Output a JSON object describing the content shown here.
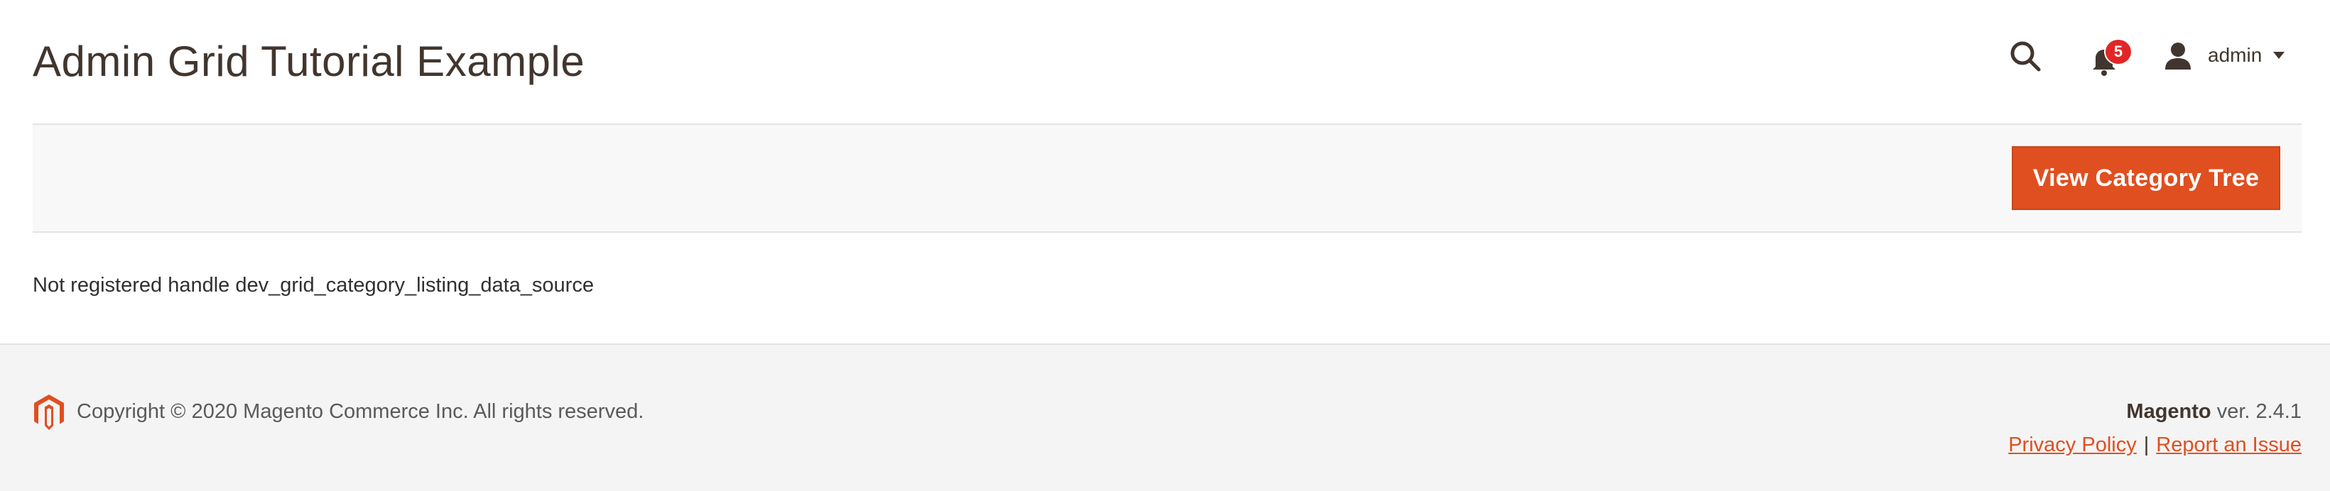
{
  "header": {
    "title": "Admin Grid Tutorial Example",
    "notifications_count": "5",
    "user_name": "admin",
    "icons": [
      "search-icon",
      "bell-icon",
      "user-icon",
      "caret-down-icon"
    ]
  },
  "actions": {
    "view_category_tree_label": "View Category Tree"
  },
  "content": {
    "message": "Not registered handle dev_grid_category_listing_data_source"
  },
  "footer": {
    "copyright": "Copyright © 2020 Magento Commerce Inc. All rights reserved.",
    "brand": "Magento",
    "version": "ver. 2.4.1",
    "privacy_link": "Privacy Policy",
    "separator": "|",
    "report_link": "Report an Issue"
  },
  "colors": {
    "accent": "#e04f20",
    "badge": "#e22626",
    "text_dark": "#41362f",
    "footer_bg": "#f4f4f4"
  }
}
